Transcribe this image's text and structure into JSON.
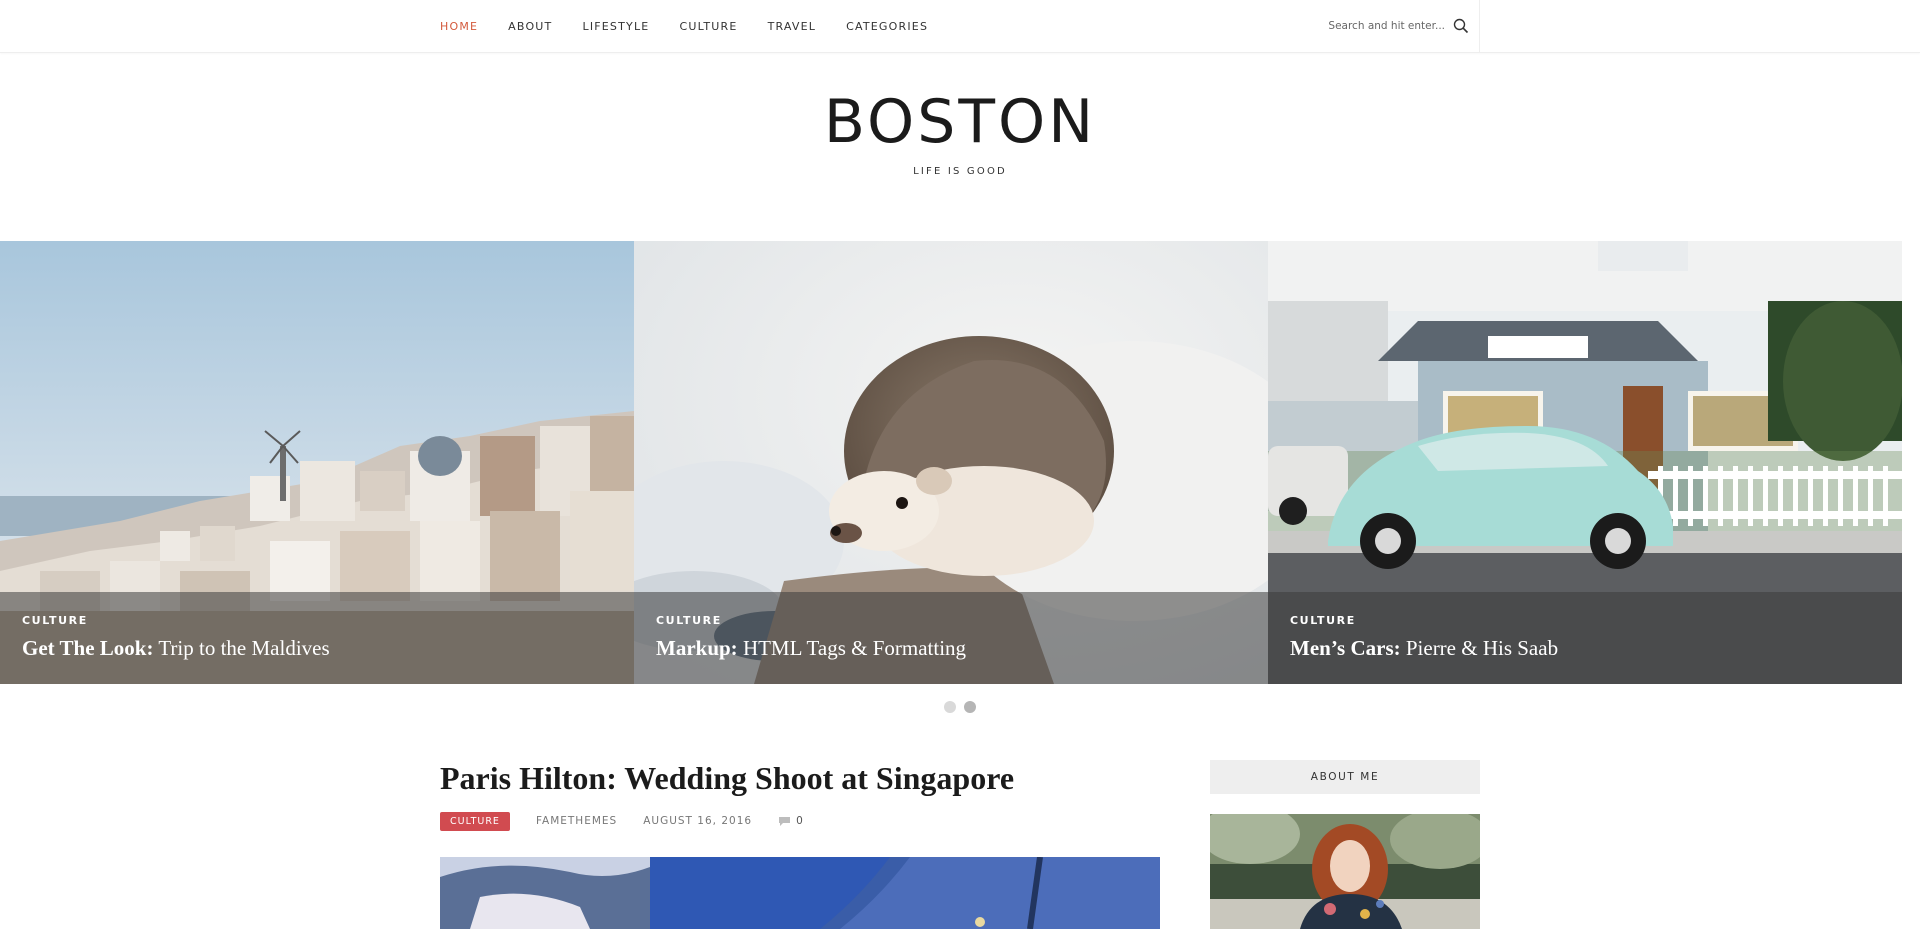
{
  "nav": {
    "items": [
      {
        "label": "HOME",
        "active": true
      },
      {
        "label": "ABOUT",
        "active": false
      },
      {
        "label": "LIFESTYLE",
        "active": false
      },
      {
        "label": "CULTURE",
        "active": false
      },
      {
        "label": "TRAVEL",
        "active": false
      },
      {
        "label": "CATEGORIES",
        "active": false
      }
    ],
    "search_placeholder": "Search and hit enter...",
    "search_icon": "search-icon",
    "active_color": "#d35a3c"
  },
  "header": {
    "title": "BOSTON",
    "tagline": "LIFE IS GOOD"
  },
  "slider": {
    "slides": [
      {
        "category": "CULTURE",
        "title_bold": "Get The Look:",
        "title_rest": " Trip to the Maldives"
      },
      {
        "category": "CULTURE",
        "title_bold": "Markup:",
        "title_rest": " HTML Tags & Formatting"
      },
      {
        "category": "CULTURE",
        "title_bold": "Men’s Cars:",
        "title_rest": " Pierre & His Saab"
      }
    ],
    "dots": [
      {
        "active": false
      },
      {
        "active": true
      }
    ]
  },
  "post": {
    "title_bold": "Paris Hilton:",
    "title_rest": " Wedding Shoot at Singapore",
    "category": "CULTURE",
    "author": "FAMETHEMES",
    "date": "AUGUST 16, 2016",
    "comments": "0",
    "badge_color": "#d14b50"
  },
  "sidebar": {
    "widget_title": "ABOUT ME"
  }
}
